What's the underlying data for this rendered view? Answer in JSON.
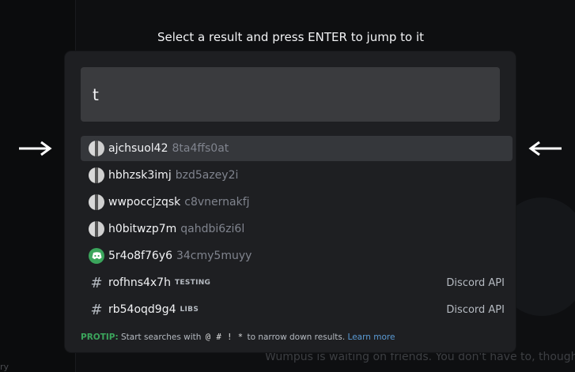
{
  "hint": "Select a result and press ENTER to jump to it",
  "search": {
    "value": "t"
  },
  "results": [
    {
      "name": "ajchsuol42",
      "sub": "8ta4ffs0at",
      "icon": "user-avatar",
      "selected": true
    },
    {
      "name": "hbhzsk3imj",
      "sub": "bzd5azey2i",
      "icon": "user-avatar"
    },
    {
      "name": "wwpoccjzqsk",
      "sub": "c8vnernakfj",
      "icon": "user-avatar"
    },
    {
      "name": "h0bitwzp7m",
      "sub": "qahdbi6zi6l",
      "icon": "user-avatar"
    },
    {
      "name": "5r4o8f76y6",
      "sub": "34cmy5muyy",
      "icon": "discord-logo"
    },
    {
      "name": "rofhns4x7h",
      "tag": "TESTING",
      "right": "Discord API",
      "icon": "hash-icon"
    },
    {
      "name": "rb54oqd9g4",
      "tag": "LIBS",
      "right": "Discord API",
      "icon": "hash-icon"
    }
  ],
  "protip": {
    "label": "PROTIP:",
    "text_before": "Start searches with",
    "symbols": [
      "@",
      "#",
      "!",
      "*"
    ],
    "text_after": "to narrow down results.",
    "link": "Learn more"
  },
  "background": {
    "bottom_text": "Wumpus is waiting on friends. You don't have to, though!",
    "left_text": "ry"
  },
  "colors": {
    "accent": "#3ba55c",
    "link": "#5b9bd5"
  }
}
